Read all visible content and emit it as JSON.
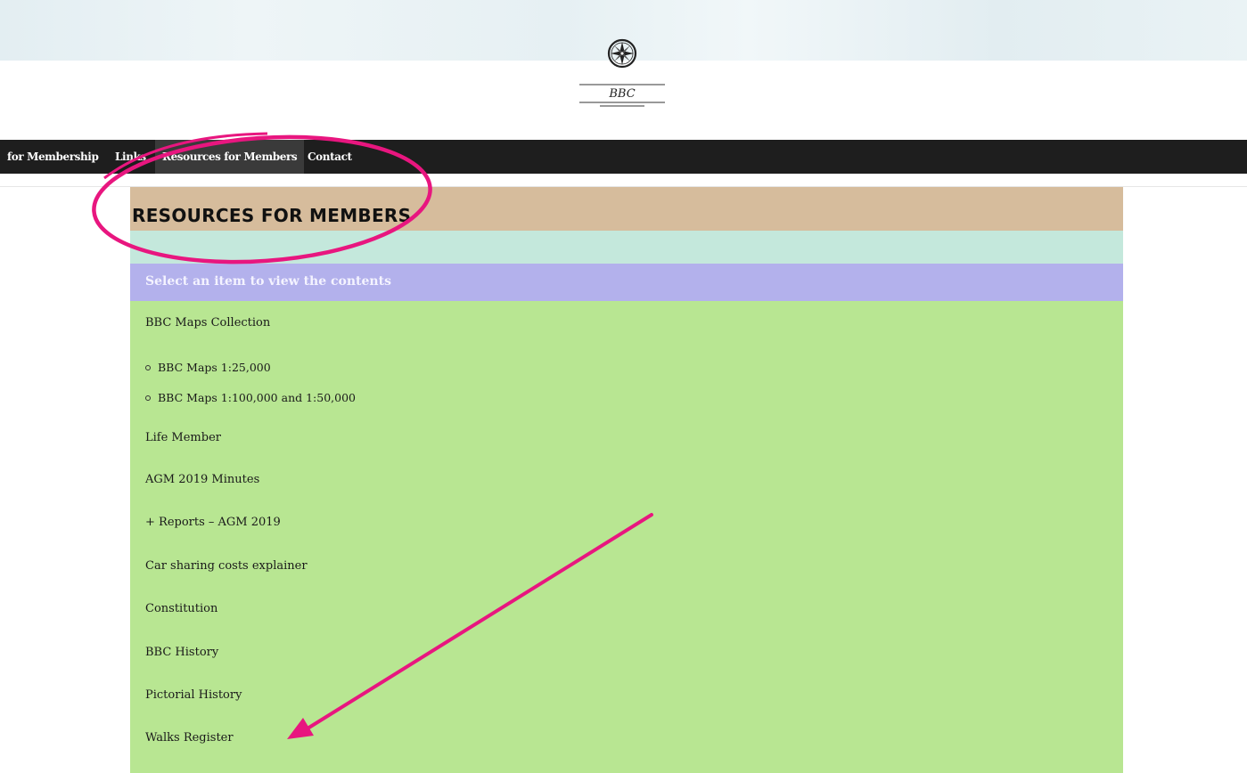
{
  "logo": {
    "text": "BBC"
  },
  "nav": {
    "items": [
      {
        "label": "for Membership"
      },
      {
        "label": "Links"
      },
      {
        "label": "Resources for Members"
      },
      {
        "label": "Contact"
      }
    ]
  },
  "page": {
    "title": "RESOURCES FOR MEMBERS",
    "select_prompt": "Select an item to view the contents",
    "items": [
      {
        "label": "BBC Maps Collection"
      },
      {
        "label": "BBC Maps 1:25,000"
      },
      {
        "label": "BBC Maps 1:100,000 and 1:50,000"
      },
      {
        "label": "Life Member"
      },
      {
        "label": "AGM 2019 Minutes"
      },
      {
        "label": "+ Reports – AGM 2019"
      },
      {
        "label": "Car sharing costs explainer"
      },
      {
        "label": "Constitution"
      },
      {
        "label": "BBC History"
      },
      {
        "label": "Pictorial History"
      },
      {
        "label": "Walks Register"
      }
    ]
  },
  "colors": {
    "nav_bg": "#1e1e1e",
    "title_bg": "#d6bc9c",
    "mint_bg": "#c4e8dc",
    "select_bg": "#b3b1ec",
    "panel_bg": "#b8e692",
    "annotation": "#e8167f"
  }
}
